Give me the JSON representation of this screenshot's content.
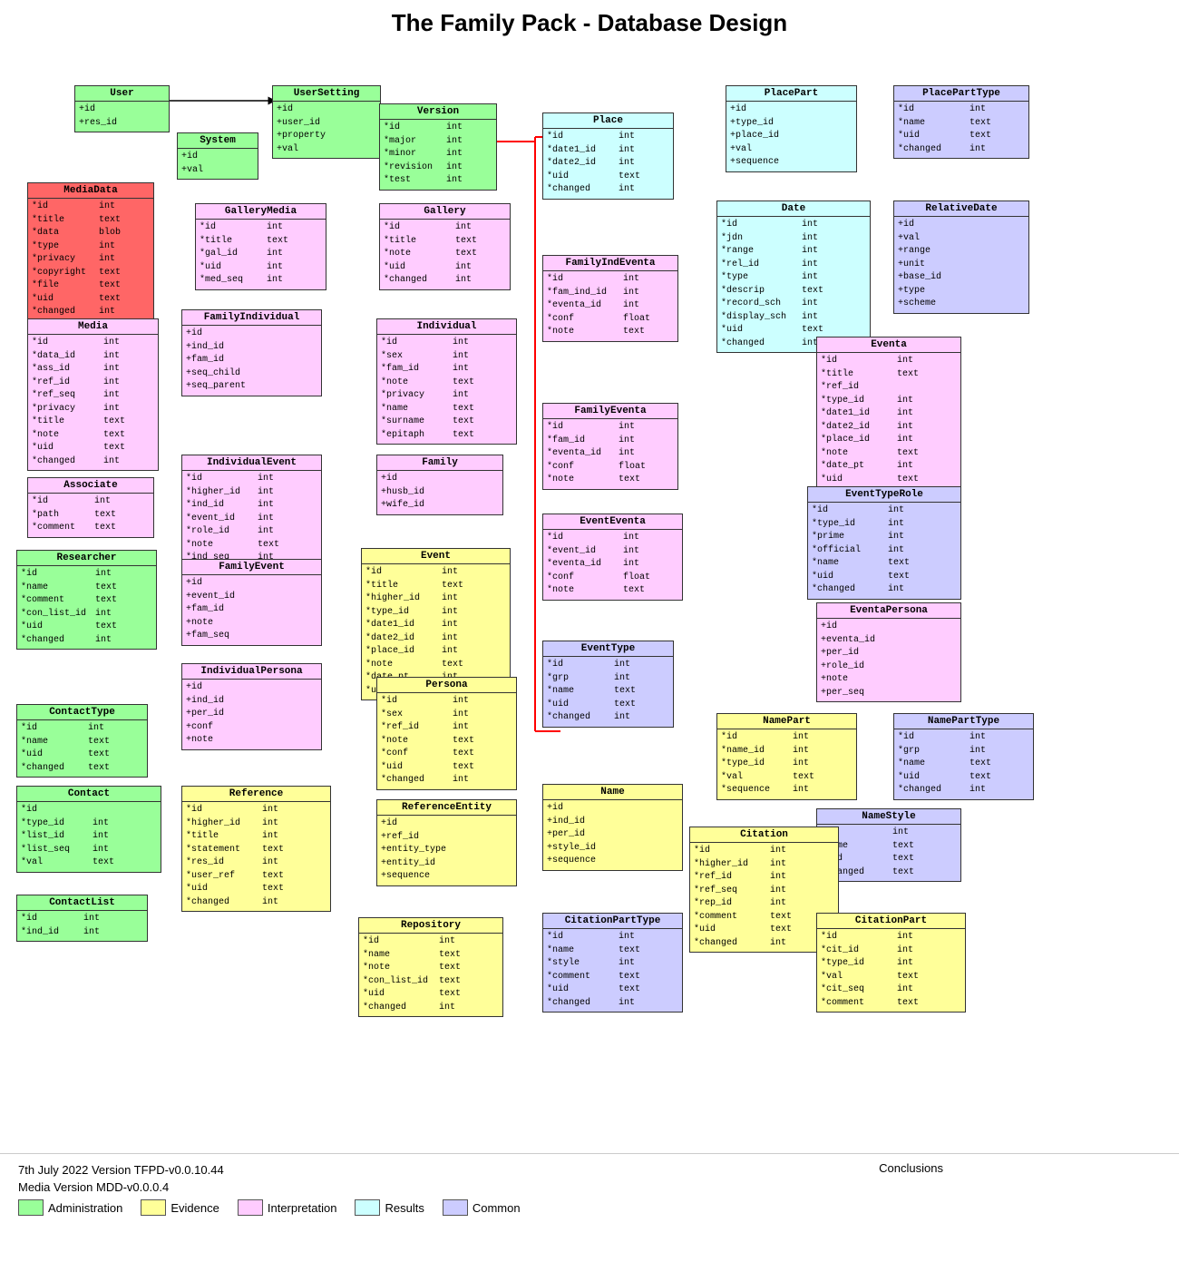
{
  "title": "The Family Pack - Database Design",
  "footer": {
    "line1": "7th July 2022  Version TFPD-v0.0.10.44",
    "line2": "Media Version MDD-v0.0.0.4",
    "conclusions": "Conclusions"
  },
  "legend": [
    {
      "label": "Administration",
      "color": "#99ff99"
    },
    {
      "label": "Evidence",
      "color": "#ffff99"
    },
    {
      "label": "Interpretation",
      "color": "#ffccff"
    },
    {
      "label": "Results",
      "color": "#ccffff"
    },
    {
      "label": "Common",
      "color": "#ccccff"
    }
  ],
  "tables": {
    "User": {
      "header": "User",
      "color": "admin",
      "fields": [
        "+id",
        "  +res_id"
      ]
    },
    "UserSetting": {
      "header": "UserSetting",
      "color": "admin",
      "fields": [
        "+id",
        "+user_id",
        "+property",
        "+val"
      ]
    },
    "System": {
      "header": "System",
      "color": "admin",
      "fields": [
        "+id",
        "+val"
      ]
    },
    "Version": {
      "header": "Version",
      "color": "admin",
      "fields": [
        "*id   int",
        "*major  int",
        "*minor  int",
        "*revision int",
        "*test  int"
      ]
    }
  }
}
